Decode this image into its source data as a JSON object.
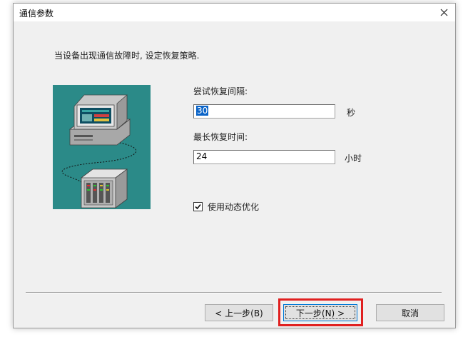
{
  "window": {
    "title": "通信参数"
  },
  "instruction": "当设备出现通信故障时, 设定恢复策略.",
  "retry_interval": {
    "label": "尝试恢复间隔:",
    "value": "30",
    "unit": "秒"
  },
  "max_recovery_time": {
    "label": "最长恢复时间:",
    "value": "24",
    "unit": "小时"
  },
  "dynamic_optimization": {
    "label": "使用动态优化",
    "checked": true
  },
  "buttons": {
    "back": "< 上一步(B)",
    "next": "下一步(N) >",
    "cancel": "取消"
  },
  "icons": {
    "close": "close-icon",
    "illustration": "computer-device-connection-illustration",
    "checkbox": "checkmark-icon"
  },
  "colors": {
    "illustration_bg": "#2b8a88",
    "highlight": "#e02020",
    "selection": "#0a64c8",
    "dialog_bg": "#f0f0f0"
  }
}
